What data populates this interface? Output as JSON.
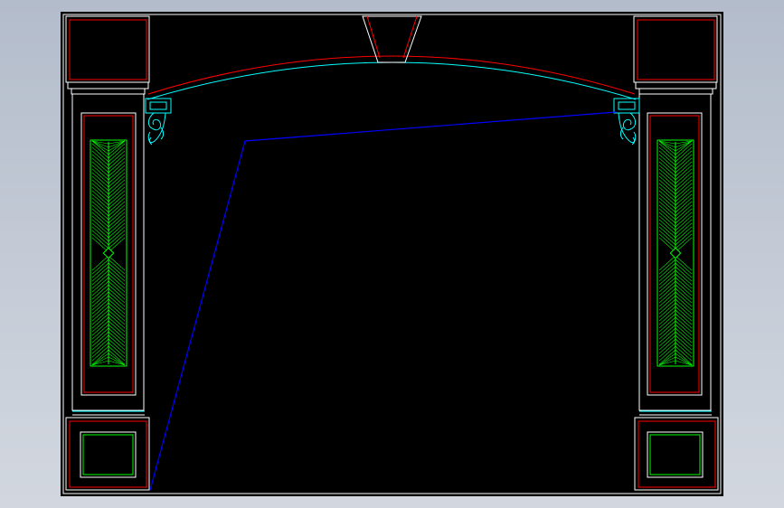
{
  "drawing": {
    "subject": "",
    "colors": {
      "background_gradient_top": "#b3bccb",
      "background_gradient_bottom": "#d2d7df",
      "canvas": "#000000",
      "outline": "#ffffff",
      "red": "#ff0000",
      "cyan": "#00ffff",
      "green": "#00ff00",
      "blue": "#0000ff"
    },
    "icons": [
      "corbel-scroll-icon",
      "leaf-pattern-panel",
      "diamond-ornament-icon"
    ]
  }
}
